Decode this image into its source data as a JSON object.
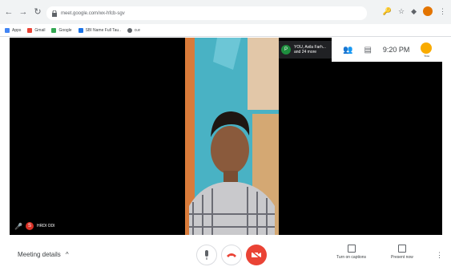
{
  "browser": {
    "url": "meet.google.com/wx-hfcb-sgv",
    "bookmarks": [
      "Apps",
      "Gmail",
      "Google",
      "SBI Name Full Tau..",
      "o.e"
    ]
  },
  "stage": {
    "self_tile_label": "HRDI ODI",
    "participants_chip": {
      "line1": "YOU, Avila Farh...",
      "line2": "and 24 more",
      "avatar_letter": "P"
    },
    "top_panel": {
      "time": "9:20 PM",
      "you_label": "You"
    }
  },
  "bottom_bar": {
    "meeting_details": "Meeting details",
    "captions_label": "Turn on captions",
    "present_label": "Present now"
  },
  "colors": {
    "hangup_red": "#ea4335",
    "center_bg": "#4fb3c7"
  }
}
